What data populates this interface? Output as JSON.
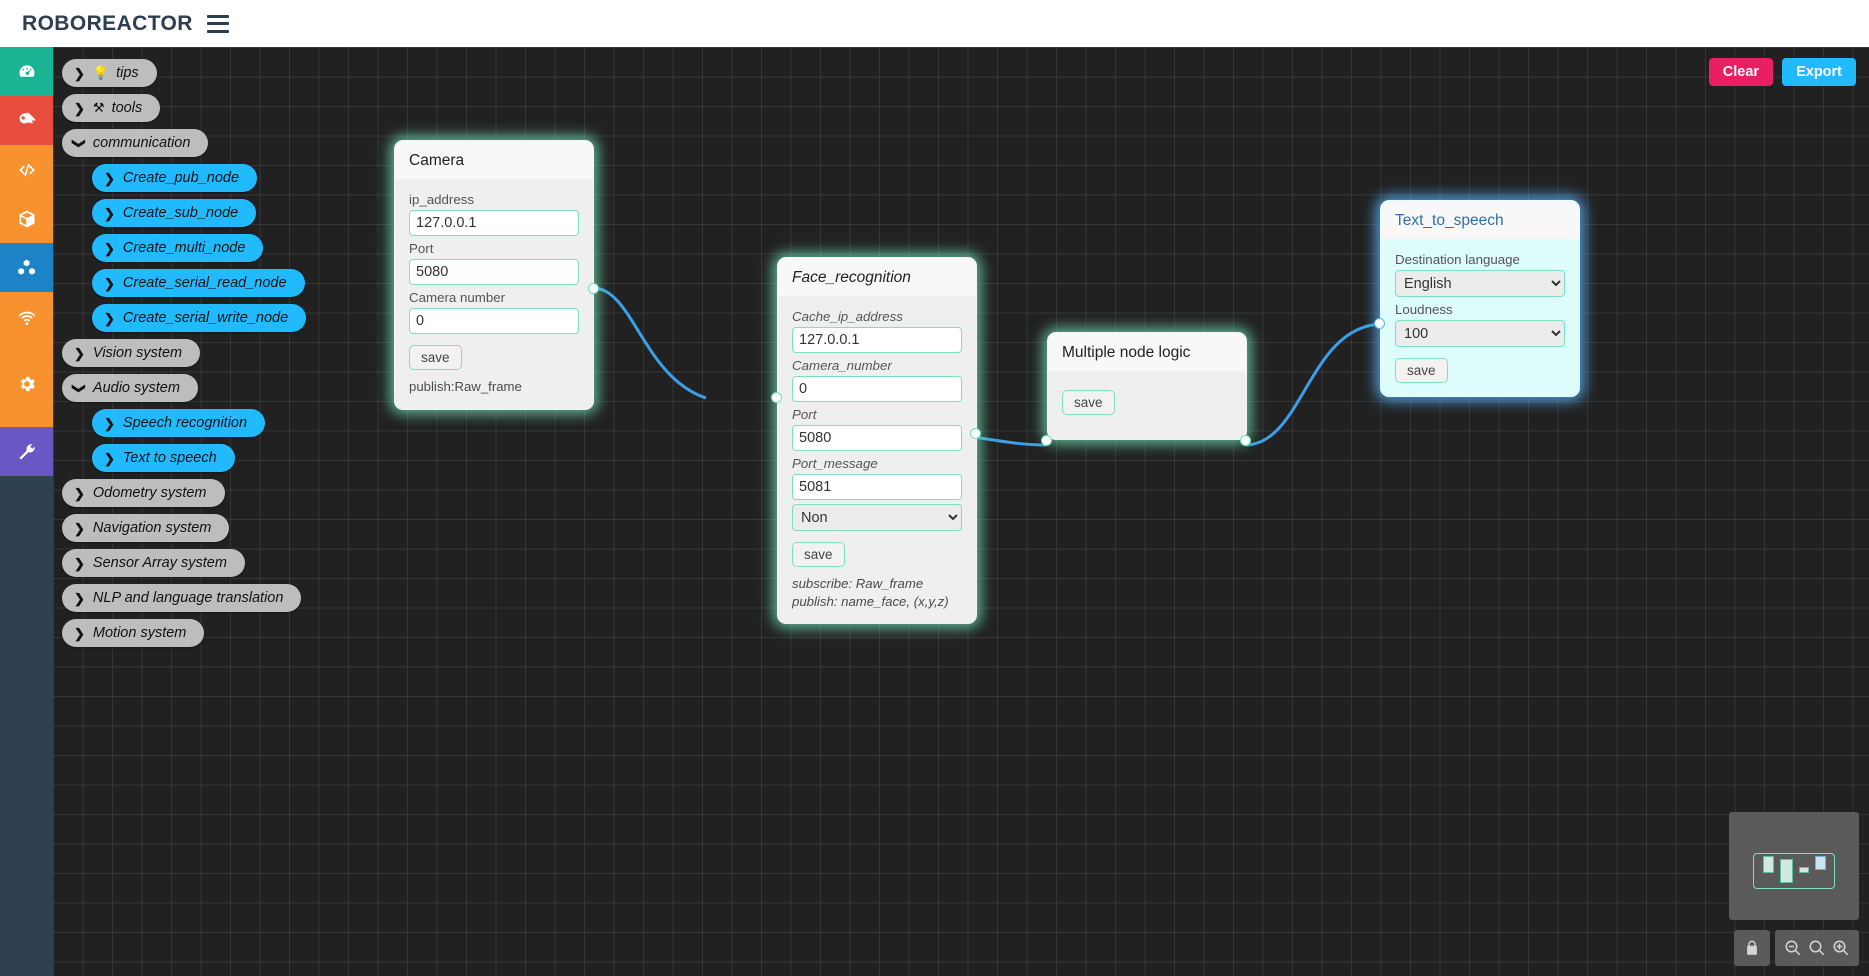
{
  "header": {
    "brand": "ROBOREACTOR",
    "menu_icon": "hamburger-icon"
  },
  "icon_rail": [
    {
      "name": "dashboard-icon",
      "color": "#1ab394"
    },
    {
      "name": "key-icon",
      "color": "#e74c3c"
    },
    {
      "name": "code-icon",
      "color": "#f8922f"
    },
    {
      "name": "cube-icon",
      "color": "#f8922f"
    },
    {
      "name": "blocks-icon",
      "color": "#1c84c6"
    },
    {
      "name": "wifi-icon",
      "color": "#f8922f"
    },
    {
      "name": "gear-icon",
      "color": "#f8922f"
    },
    {
      "name": "wrench-icon",
      "color": "#6b57c4"
    }
  ],
  "toolbar": {
    "clear_label": "Clear",
    "export_label": "Export",
    "clear_color": "#e91e63",
    "export_color": "#22baff"
  },
  "tree": [
    {
      "label": "tips",
      "style": "grey",
      "caret": "collapsed",
      "indent": 0,
      "glyph": "bulb-icon"
    },
    {
      "label": "tools",
      "style": "grey",
      "caret": "collapsed",
      "indent": 0,
      "glyph": "tools-icon"
    },
    {
      "label": "communication",
      "style": "grey",
      "caret": "expanded",
      "indent": 0,
      "glyph": ""
    },
    {
      "label": "Create_pub_node",
      "style": "blue",
      "caret": "collapsed",
      "indent": 1,
      "glyph": ""
    },
    {
      "label": "Create_sub_node",
      "style": "blue",
      "caret": "collapsed",
      "indent": 1,
      "glyph": ""
    },
    {
      "label": "Create_multi_node",
      "style": "blue",
      "caret": "collapsed",
      "indent": 1,
      "glyph": ""
    },
    {
      "label": "Create_serial_read_node",
      "style": "blue",
      "caret": "collapsed",
      "indent": 1,
      "glyph": ""
    },
    {
      "label": "Create_serial_write_node",
      "style": "blue",
      "caret": "collapsed",
      "indent": 1,
      "glyph": ""
    },
    {
      "label": "Vision system",
      "style": "grey",
      "caret": "collapsed",
      "indent": 0,
      "glyph": ""
    },
    {
      "label": "Audio system",
      "style": "grey",
      "caret": "expanded",
      "indent": 0,
      "glyph": ""
    },
    {
      "label": "Speech recognition",
      "style": "blue",
      "caret": "collapsed",
      "indent": 1,
      "glyph": ""
    },
    {
      "label": "Text to speech",
      "style": "blue",
      "caret": "collapsed",
      "indent": 1,
      "glyph": ""
    },
    {
      "label": "Odometry system",
      "style": "grey",
      "caret": "collapsed",
      "indent": 0,
      "glyph": ""
    },
    {
      "label": "Navigation system",
      "style": "grey",
      "caret": "collapsed",
      "indent": 0,
      "glyph": ""
    },
    {
      "label": "Sensor Array system",
      "style": "grey",
      "caret": "collapsed",
      "indent": 0,
      "glyph": ""
    },
    {
      "label": "NLP and language translation",
      "style": "grey",
      "caret": "collapsed",
      "indent": 0,
      "glyph": ""
    },
    {
      "label": "Motion system",
      "style": "grey",
      "caret": "collapsed",
      "indent": 0,
      "glyph": ""
    }
  ],
  "nodes": {
    "camera": {
      "title": "Camera",
      "fields": [
        {
          "label": "ip_address",
          "value": "127.0.0.1"
        },
        {
          "label": "Port",
          "value": "5080"
        },
        {
          "label": "Camera number",
          "value": "0"
        }
      ],
      "save_label": "save",
      "io": "publish:Raw_frame"
    },
    "face_recognition": {
      "title": "Face_recognition",
      "fields": [
        {
          "label": "Cache_ip_address",
          "value": "127.0.0.1"
        },
        {
          "label": "Camera_number",
          "value": "0"
        },
        {
          "label": "Port",
          "value": "5080"
        },
        {
          "label": "Port_message",
          "value": "5081"
        }
      ],
      "select_value": "Non",
      "save_label": "save",
      "io_line1": "subscribe: Raw_frame",
      "io_line2": "publish: name_face, (x,y,z)"
    },
    "multiple_node_logic": {
      "title": "Multiple node logic",
      "save_label": "save"
    },
    "text_to_speech": {
      "title": "Text_to_speech",
      "fields": [
        {
          "label": "Destination language",
          "value": "English"
        },
        {
          "label": "Loudness",
          "value": "100"
        }
      ],
      "save_label": "save"
    }
  },
  "minimap": {
    "lock_icon": "lock-icon",
    "zoom_out_icon": "zoom-out-icon",
    "zoom_reset_icon": "zoom-fit-icon",
    "zoom_in_icon": "zoom-in-icon"
  }
}
